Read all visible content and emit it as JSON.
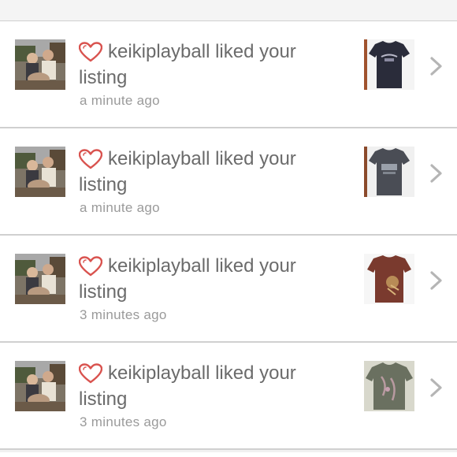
{
  "notifications": [
    {
      "username": "keikiplayball",
      "message": "keikiplayball liked your listing",
      "time": "a minute ago",
      "item_color": "#2a2c3a",
      "item_accent": "#b8b8c8"
    },
    {
      "username": "keikiplayball",
      "message": "keikiplayball liked your listing",
      "time": "a minute ago",
      "item_color": "#4a4d55",
      "item_accent": "#9aa0aa"
    },
    {
      "username": "keikiplayball",
      "message": "keikiplayball liked your listing",
      "time": "3 minutes ago",
      "item_color": "#7a3a2e",
      "item_accent": "#c8a060"
    },
    {
      "username": "keikiplayball",
      "message": "keikiplayball liked your listing",
      "time": "3 minutes ago",
      "item_color": "#6a7060",
      "item_accent": "#b89aa0"
    }
  ],
  "colors": {
    "heart": "#d9534f",
    "text": "#6b6b6b",
    "timestamp": "#9a9a9a",
    "chevron": "#b5b5b5"
  },
  "icons": {
    "like": "heart-outline-icon",
    "open": "chevron-right-icon"
  }
}
